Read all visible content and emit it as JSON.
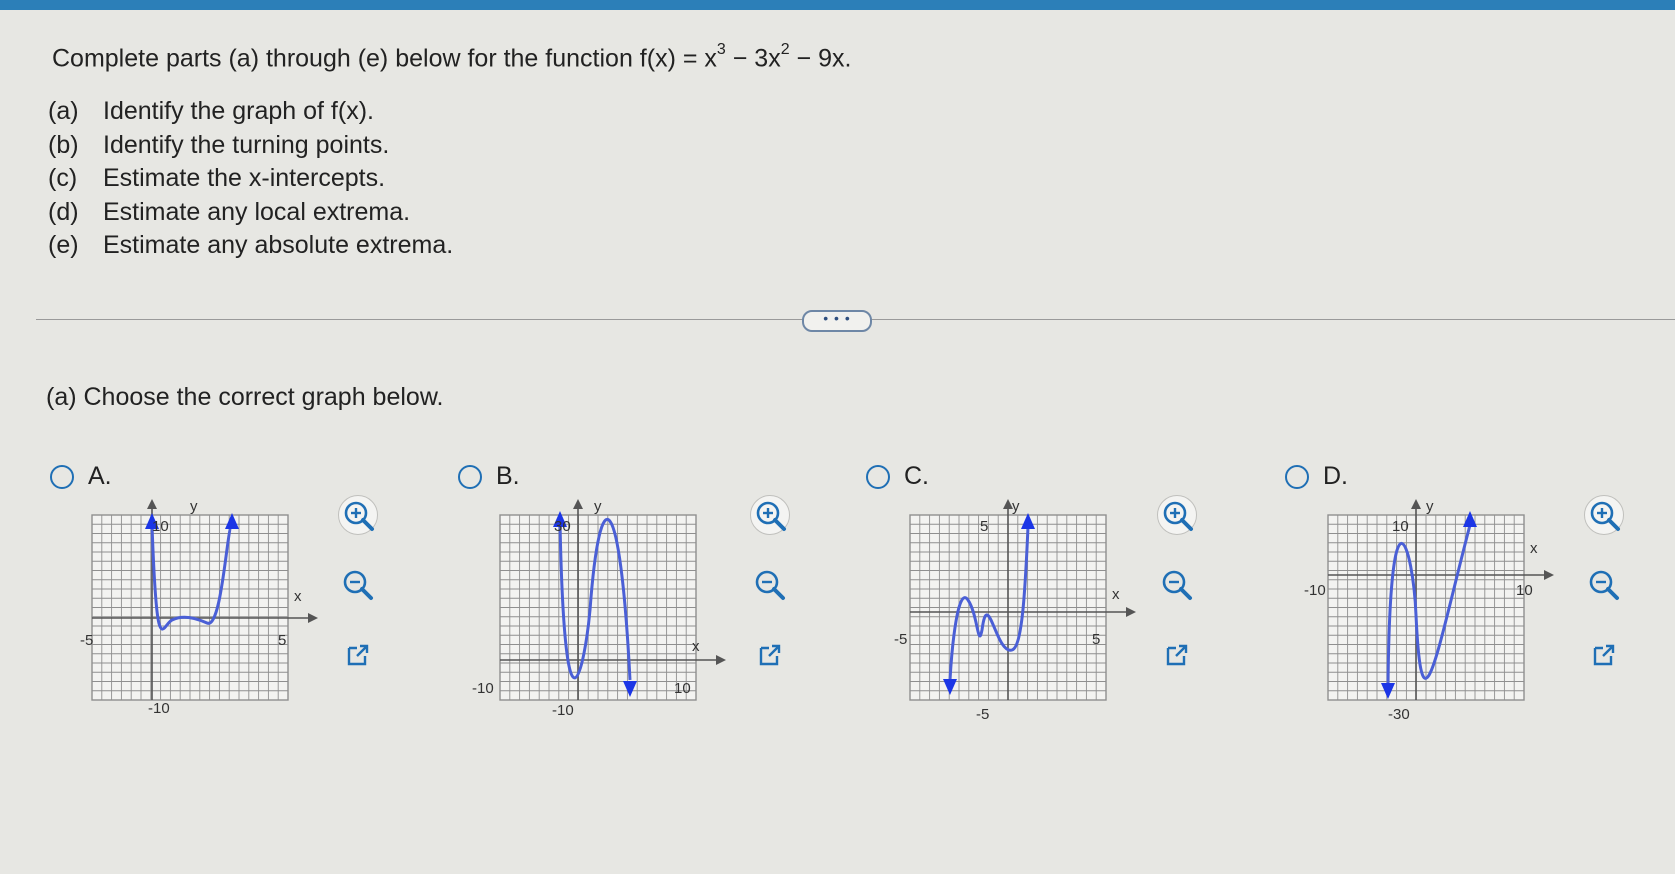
{
  "question": {
    "lead": "Complete parts (a) through (e) below for the function f(x) = x",
    "exp1": "3",
    "mid": " − 3x",
    "exp2": "2",
    "tail": " − 9x.",
    "parts": [
      {
        "label": "(a)",
        "text": "Identify the graph of f(x)."
      },
      {
        "label": "(b)",
        "text": "Identify the turning points."
      },
      {
        "label": "(c)",
        "text": "Estimate the x-intercepts."
      },
      {
        "label": "(d)",
        "text": "Estimate any local extrema."
      },
      {
        "label": "(e)",
        "text": "Estimate any absolute extrema."
      }
    ]
  },
  "more_button": "• • •",
  "prompt": "(a) Choose the correct graph below.",
  "colors": {
    "curve": "#4a5fd6",
    "arrow": "#1c36e6",
    "grid": "#8f8f8f",
    "accent": "#1f6fb5"
  },
  "options": [
    {
      "letter": "A.",
      "labels": {
        "y": "y",
        "x": "x",
        "top": "10",
        "bottom": "-10",
        "left": "-5",
        "right": "5"
      }
    },
    {
      "letter": "B.",
      "labels": {
        "y": "y",
        "x": "x",
        "top": "30",
        "bottom": "-10",
        "left": "-10",
        "right": "10"
      }
    },
    {
      "letter": "C.",
      "labels": {
        "y": "y",
        "x": "x",
        "top": "5",
        "bottom": "-5",
        "left": "-5",
        "right": "5"
      }
    },
    {
      "letter": "D.",
      "labels": {
        "y": "y",
        "x": "x",
        "top": "10",
        "bottom": "-30",
        "left": "-10",
        "right": "10"
      }
    }
  ],
  "tool_icons": [
    "zoom-in-icon",
    "zoom-out-icon",
    "open-new-window-icon"
  ]
}
